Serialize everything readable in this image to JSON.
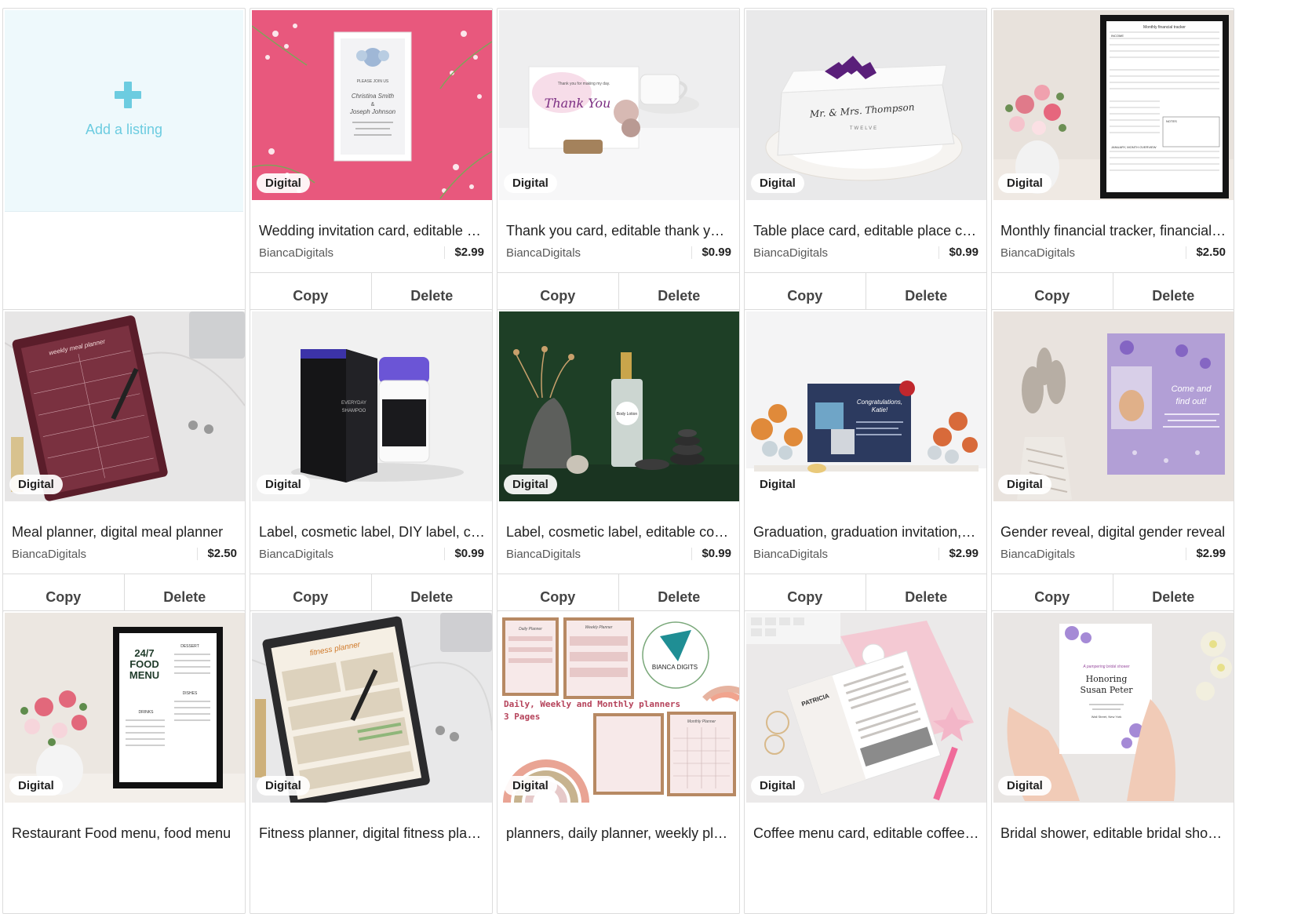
{
  "add_listing": {
    "label": "Add a listing"
  },
  "listings": [
    {
      "badge": "Digital",
      "title": "Wedding invitation card, editable wedding invitation",
      "shop": "BiancaDigitals",
      "price": "$2.99",
      "copy": "Copy",
      "delete": "Delete",
      "image": "wedding-invitation"
    },
    {
      "badge": "Digital",
      "title": "Thank you card, editable thank you card",
      "shop": "BiancaDigitals",
      "price": "$0.99",
      "copy": "Copy",
      "delete": "Delete",
      "image": "thank-you-card"
    },
    {
      "badge": "Digital",
      "title": "Table place card, editable place card",
      "shop": "BiancaDigitals",
      "price": "$0.99",
      "copy": "Copy",
      "delete": "Delete",
      "image": "place-card"
    },
    {
      "badge": "Digital",
      "title": "Monthly financial tracker, financial planner",
      "shop": "BiancaDigitals",
      "price": "$2.50",
      "copy": "Copy",
      "delete": "Delete",
      "image": "financial-tracker"
    },
    {
      "badge": "Digital",
      "title": "Meal planner, digital meal planner",
      "shop": "BiancaDigitals",
      "price": "$2.50",
      "copy": "Copy",
      "delete": "Delete",
      "image": "meal-planner"
    },
    {
      "badge": "Digital",
      "title": "Label, cosmetic label, DIY label, cosmetic",
      "shop": "BiancaDigitals",
      "price": "$0.99",
      "copy": "Copy",
      "delete": "Delete",
      "image": "shampoo-label"
    },
    {
      "badge": "Digital",
      "title": "Label, cosmetic label, editable cosmetic label",
      "shop": "BiancaDigitals",
      "price": "$0.99",
      "copy": "Copy",
      "delete": "Delete",
      "image": "perfume-label"
    },
    {
      "badge": "Digital",
      "title": "Graduation, graduation invitation, graduation",
      "shop": "BiancaDigitals",
      "price": "$2.99",
      "copy": "Copy",
      "delete": "Delete",
      "image": "graduation-invitation"
    },
    {
      "badge": "Digital",
      "title": "Gender reveal, digital gender reveal",
      "shop": "BiancaDigitals",
      "price": "$2.99",
      "copy": "Copy",
      "delete": "Delete",
      "image": "gender-reveal"
    },
    {
      "badge": "Digital",
      "title": "Restaurant Food menu, food menu",
      "shop": "",
      "price": "",
      "copy": "",
      "delete": "",
      "image": "food-menu"
    },
    {
      "badge": "Digital",
      "title": "Fitness planner, digital fitness planner",
      "shop": "",
      "price": "",
      "copy": "",
      "delete": "",
      "image": "fitness-planner"
    },
    {
      "badge": "Digital",
      "title": "planners, daily planner, weekly planner",
      "shop": "",
      "price": "",
      "copy": "",
      "delete": "",
      "image": "planners-set"
    },
    {
      "badge": "Digital",
      "title": "Coffee menu card, editable coffee menu",
      "shop": "",
      "price": "",
      "copy": "",
      "delete": "",
      "image": "coffee-menu"
    },
    {
      "badge": "Digital",
      "title": "Bridal shower, editable bridal shower invitation",
      "shop": "",
      "price": "",
      "copy": "",
      "delete": "",
      "image": "bridal-shower"
    }
  ],
  "image_text": {
    "wedding": [
      "PLEASE JOIN US",
      "Christina Smith",
      "&",
      "Joseph Johnson"
    ],
    "thankyou": [
      "Thank you for making my day.",
      "Thank You"
    ],
    "placecard": [
      "Mr. & Mrs. Thompson",
      "TWELVE"
    ],
    "tracker": [
      "Monthly financial tracker",
      "INCOME",
      "NOTES",
      "JANUARY, MONTH OVERVIEW"
    ],
    "meal": [
      "weekly meal planner"
    ],
    "shampoo": [
      "EVERYDAY",
      "SHAMPOO"
    ],
    "perfume": [
      "Body Lotion"
    ],
    "graduation": [
      "Congratulations,",
      "Katie!"
    ],
    "gender": [
      "Come and",
      "find out!"
    ],
    "foodmenu": [
      "24/7",
      "FOOD",
      "MENU",
      "DESSERT",
      "DRINKS",
      "DISHES"
    ],
    "fitness": [
      "fitness planner"
    ],
    "planners": [
      "Daily, Weekly and Monthly planners",
      "3 Pages",
      "BIANCA DIGITS",
      "Daily Planner",
      "Weekly Planner",
      "Monthly Planner"
    ],
    "coffee": [
      "PATRICIA"
    ],
    "bridal": [
      "A pampering bridal shower",
      "Honoring",
      "Susan Peter",
      "Wall Street, New York"
    ]
  },
  "colors": {
    "accent": "#6ccce0",
    "add_bg": "#eef9fc",
    "border": "#dcdcdc"
  }
}
